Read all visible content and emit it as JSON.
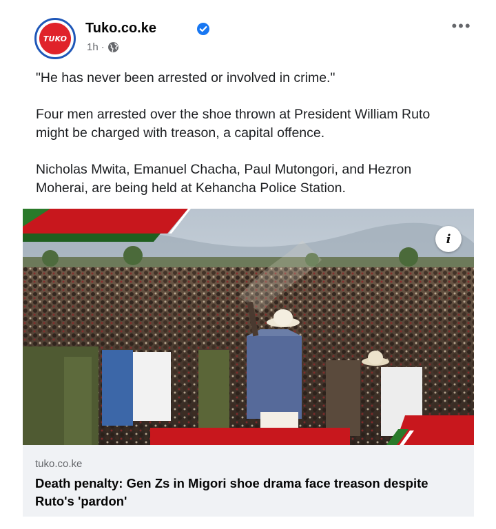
{
  "post": {
    "avatar_text": "TUKO",
    "page_name": "Tuko.co.ke",
    "time": "1h",
    "separator": "·",
    "more_label": "•••",
    "paragraphs": [
      "\"He has never been arrested or involved in crime.\"",
      "Four men arrested over the shoe thrown at President William Ruto might be charged with treason, a capital offence.",
      "Nicholas Mwita, Emanuel Chacha, Paul Mutongori, and Hezron Moherai, are being held at Kehancha Police Station."
    ]
  },
  "link_card": {
    "info_label": "i",
    "domain": "tuko.co.ke",
    "title": "Death penalty: Gen Zs in Migori shoe drama face treason despite Ruto's 'pardon'"
  },
  "colors": {
    "brand_red": "#e0232a",
    "avatar_ring": "#1f57b8",
    "verified_blue": "#1877f2",
    "secondary_text": "#65676b",
    "card_bg": "#f0f2f5",
    "stage_red": "#c8171d",
    "accent_green": "#2a7a2a"
  },
  "icons": [
    "verified-badge-icon",
    "globe-icon",
    "more-options-icon",
    "info-icon"
  ]
}
